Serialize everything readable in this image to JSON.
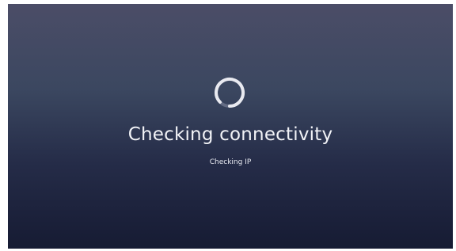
{
  "screen": {
    "title": "Checking connectivity",
    "status": "Checking IP"
  },
  "spinner": {
    "icon": "loading-spinner-icon",
    "color": "#e9eaf0",
    "track_color": "#8b8fa5"
  }
}
